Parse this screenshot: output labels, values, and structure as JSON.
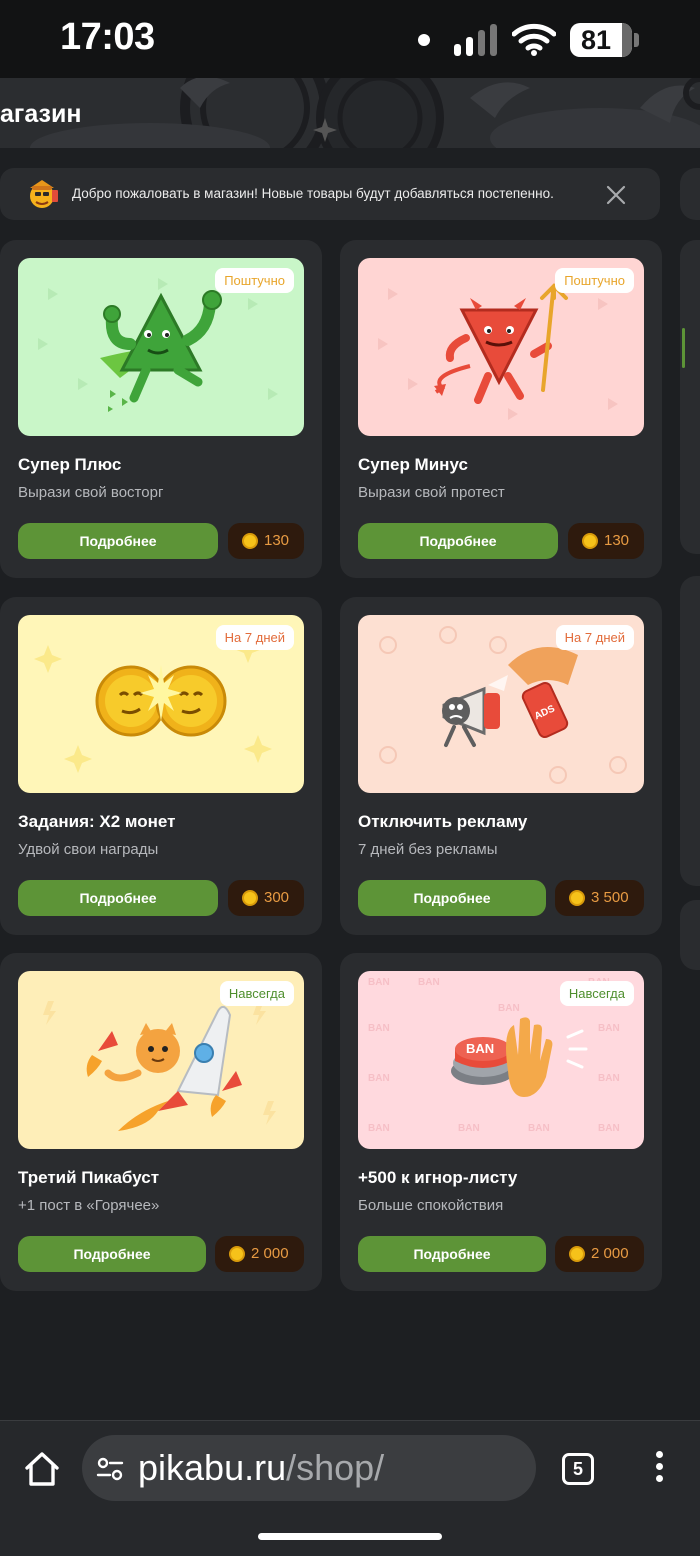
{
  "status_bar": {
    "time": "17:03",
    "battery": "81"
  },
  "page": {
    "title": "агазин"
  },
  "notice": {
    "text": "Добро пожаловать в магазин! Новые товары будут добавляться постепенно."
  },
  "products": [
    {
      "badge": "Поштучно",
      "title": "Супер Плюс",
      "description": "Вырази свой восторг",
      "button": "Подробнее",
      "price": "130"
    },
    {
      "badge": "Поштучно",
      "title": "Супер Минус",
      "description": "Вырази свой протест",
      "button": "Подробнее",
      "price": "130"
    },
    {
      "badge": "На 7 дней",
      "title": "Задания: X2 монет",
      "description": "Удвой свои награды",
      "button": "Подробнее",
      "price": "300"
    },
    {
      "badge": "На 7 дней",
      "title": "Отключить рекламу",
      "description": "7 дней без рекламы",
      "button": "Подробнее",
      "price": "3 500"
    },
    {
      "badge": "Навсегда",
      "title": "Третий Пикабуст",
      "description": "+1 пост в «Горячее»",
      "button": "Подробнее",
      "price": "2 000"
    },
    {
      "badge": "Навсегда",
      "title": "+500 к игнор-листу",
      "description": "Больше спокойствия",
      "button": "Подробнее",
      "price": "2 000"
    }
  ],
  "browser": {
    "url_host": "pikabu.ru",
    "url_path": "/shop/",
    "tab_count": "5"
  },
  "colors": {
    "accent_green": "#5d9437",
    "price_text": "#e89b43",
    "badge_orange": "#e8a52b",
    "background": "#1d1f22",
    "card": "#2a2c2f"
  },
  "icons": [
    "signal-icon",
    "wifi-icon",
    "battery-icon",
    "mascot-icon",
    "close-icon",
    "coin-icon",
    "home-icon",
    "site-settings-icon",
    "tabs-icon",
    "more-menu-icon"
  ]
}
